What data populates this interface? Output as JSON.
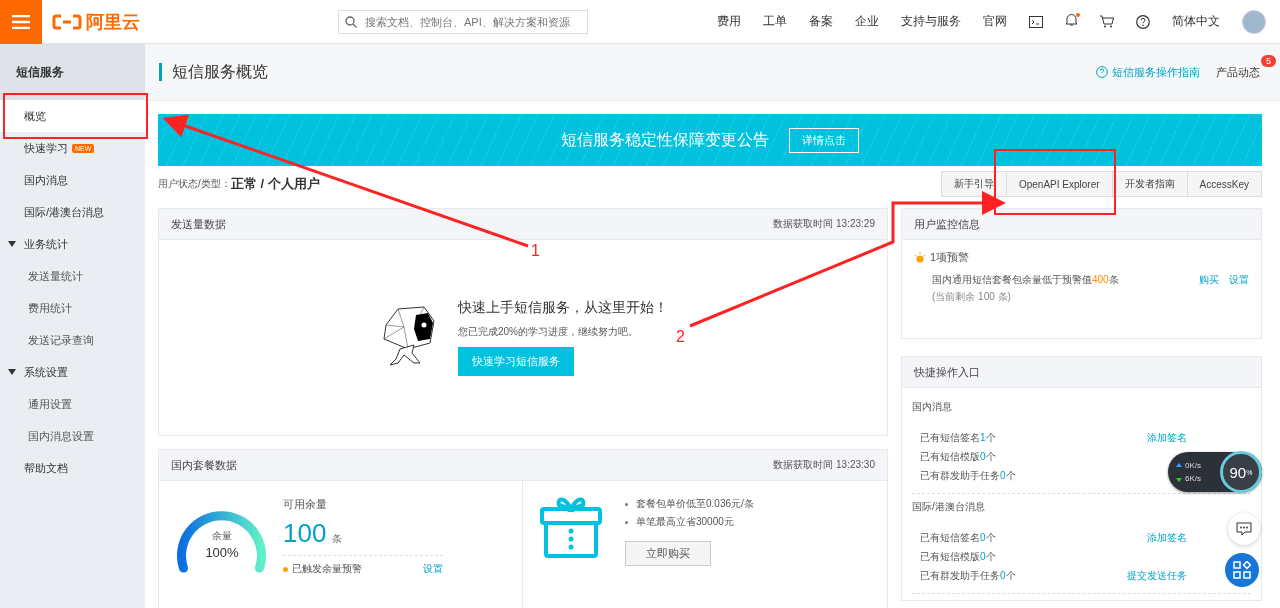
{
  "topbar": {
    "logo_text": "阿里云",
    "search": {
      "placeholder": "搜索文档、控制台、API、解决方案和资源"
    },
    "nav": [
      "费用",
      "工单",
      "备案",
      "企业",
      "支持与服务",
      "官网"
    ],
    "bell_dot": true,
    "language": "简体中文"
  },
  "sidebar": {
    "title": "短信服务",
    "items": [
      {
        "kind": "link",
        "label": "概览",
        "selected": true
      },
      {
        "kind": "link",
        "label": "快速学习",
        "badge": "NEW",
        "selected": false
      },
      {
        "kind": "link",
        "label": "国内消息",
        "selected": false
      },
      {
        "kind": "link",
        "label": "国际/港澳台消息",
        "selected": false
      },
      {
        "kind": "group",
        "label": "业务统计",
        "expanded": true,
        "children": [
          {
            "label": "发送量统计",
            "selected": false
          },
          {
            "label": "费用统计",
            "selected": false
          },
          {
            "label": "发送记录查询",
            "selected": false
          }
        ]
      },
      {
        "kind": "group",
        "label": "系统设置",
        "expanded": true,
        "children": [
          {
            "label": "通用设置",
            "selected": false
          },
          {
            "label": "国内消息设置",
            "selected": false
          }
        ]
      },
      {
        "kind": "link",
        "label": "帮助文档",
        "selected": false
      }
    ]
  },
  "header": {
    "title": "短信服务概览",
    "guide_link": "短信服务操作指南",
    "news": "产品动态",
    "news_count": "5"
  },
  "banner": {
    "text": "短信服务稳定性保障变更公告",
    "button": "详情点击"
  },
  "user_status": {
    "label": "用户状态/类型：",
    "value": "正常 / 个人用户"
  },
  "quick_buttons": [
    "新手引导",
    "OpenAPI Explorer",
    "开发者指南",
    "AccessKey"
  ],
  "send_card": {
    "title": "发送量数据",
    "time": "数据获取时间 13:23:29",
    "headline": "快速上手短信服务，从这里开始！",
    "progress_text": "您已完成20%的学习进度，继续努力吧。",
    "button": "快速学习短信服务"
  },
  "package_card": {
    "title": "国内套餐数据",
    "time": "数据获取时间 13:23:30",
    "gauge": {
      "label": "余量",
      "percent": "100%",
      "level": 1.0
    },
    "available_label": "可用余量",
    "available_value": "100",
    "unit": "条",
    "warning": "已触发余量预警",
    "warning_link": "设置",
    "bullets": [
      "套餐包单价低至0.036元/条",
      "单笔最高立省30000元"
    ],
    "buy_button": "立即购买"
  },
  "monitor_card": {
    "title": "用户监控信息",
    "alert_title": "1项预警",
    "alert_before": "国内通用短信套餐包余量低于预警值",
    "alert_value": "400",
    "alert_after": "条",
    "links": [
      "购买",
      "设置"
    ],
    "remaining": "(当前剩余 100 条)"
  },
  "shortcut_card": {
    "title": "快捷操作入口",
    "sections": [
      {
        "title": "国内消息",
        "rows": [
          {
            "text": "已有短信签名",
            "count": "1",
            "unit": "个",
            "action": "添加签名"
          },
          {
            "text": "已有短信模版",
            "count": "0",
            "unit": "个"
          },
          {
            "text": "已有群发助手任务",
            "count": "0",
            "unit": "个"
          }
        ]
      },
      {
        "title": "国际/港澳台消息",
        "rows": [
          {
            "text": "已有短信签名",
            "count": "0",
            "unit": "个",
            "action": "添加签名"
          },
          {
            "text": "已有短信模版",
            "count": "0",
            "unit": "个"
          },
          {
            "text": "已有群发助手任务",
            "count": "0",
            "unit": "个",
            "action": "提交发送任务"
          }
        ]
      }
    ]
  },
  "speed_widget": {
    "up": "0K/s",
    "down": "6K/s",
    "percent": "90",
    "percent_sign": "%"
  },
  "annotations": {
    "labels": [
      "1",
      "2"
    ]
  }
}
